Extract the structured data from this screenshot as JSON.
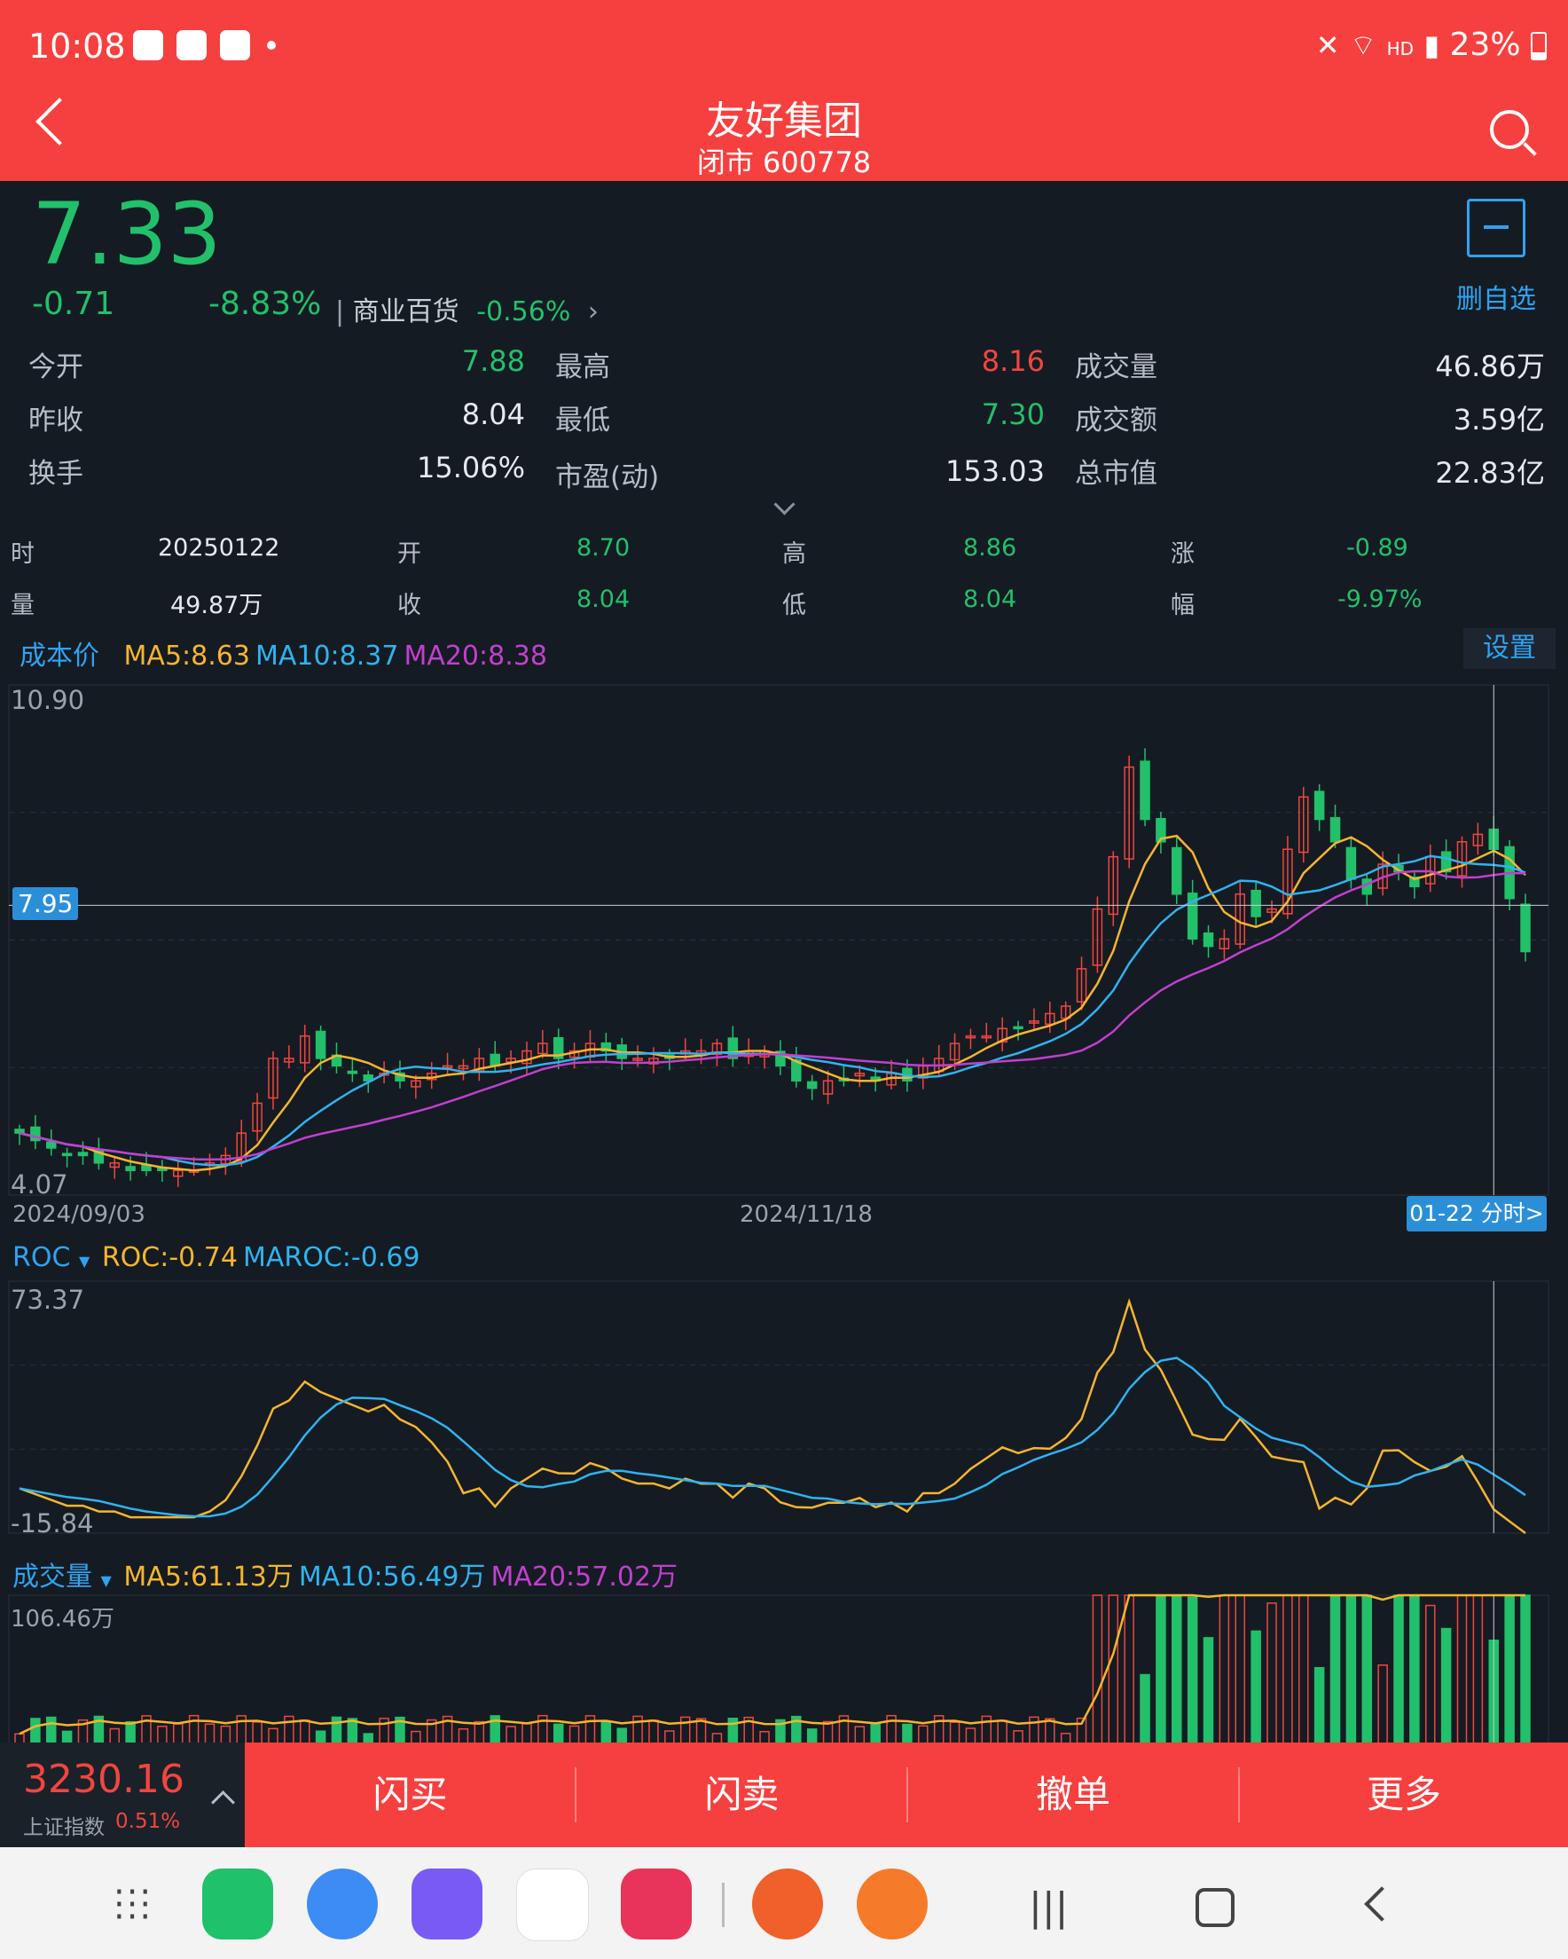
{
  "status": {
    "time": "10:08",
    "battery": "23%",
    "net": "HD"
  },
  "header": {
    "title": "友好集团",
    "subtitle": "闭市 600778"
  },
  "quote": {
    "price": "7.33",
    "change": "-0.71",
    "change_pct": "-8.83%",
    "sector_name": "商业百货",
    "sector_chg": "-0.56%",
    "fav_label": "删自选"
  },
  "stats": {
    "open_l": "今开",
    "open_v": "7.88",
    "high_l": "最高",
    "high_v": "8.16",
    "vol_l": "成交量",
    "vol_v": "46.86万",
    "prev_l": "昨收",
    "prev_v": "8.04",
    "low_l": "最低",
    "low_v": "7.30",
    "amt_l": "成交额",
    "amt_v": "3.59亿",
    "turn_l": "换手",
    "turn_v": "15.06%",
    "pe_l": "市盈(动)",
    "pe_v": "153.03",
    "cap_l": "总市值",
    "cap_v": "22.83亿"
  },
  "bar_info": {
    "time_l": "时",
    "time_v": "20250122",
    "open_l": "开",
    "open_v": "8.70",
    "high_l": "高",
    "high_v": "8.86",
    "chg_l": "涨",
    "chg_v": "-0.89",
    "vol_l": "量",
    "vol_v": "49.87万",
    "close_l": "收",
    "close_v": "8.04",
    "low_l": "低",
    "low_v": "8.04",
    "pct_l": "幅",
    "pct_v": "-9.97%"
  },
  "kline": {
    "cost_label": "成本价",
    "ma5": "MA5:8.63",
    "ma10": "MA10:8.37",
    "ma20": "MA20:8.38",
    "settings": "设置",
    "y_max": "10.90",
    "y_min": "4.07",
    "cross_price": "7.95",
    "date_start": "2024/09/03",
    "date_mid": "2024/11/18",
    "minute_btn": "01-22 分时>"
  },
  "roc": {
    "name": "ROC",
    "roc": "ROC:-0.74",
    "maroc": "MAROC:-0.69",
    "y_max": "73.37",
    "y_min": "-15.84"
  },
  "volume": {
    "name": "成交量",
    "ma5": "MA5:61.13万",
    "ma10": "MA10:56.49万",
    "ma20": "MA20:57.02万",
    "y_max": "106.46万"
  },
  "index": {
    "value": "3230.16",
    "name": "上证指数",
    "chg": "0.51%"
  },
  "trade": {
    "buy": "闪买",
    "sell": "闪卖",
    "cancel": "撤单",
    "more": "更多"
  },
  "colors": {
    "up": "#f0463f",
    "down": "#22c06a",
    "ma5": "#f5b52e",
    "ma10": "#2fb3f0",
    "ma20": "#c23fd0",
    "accent": "#f5403f"
  },
  "chart_data": [
    {
      "type": "candlestick",
      "title": "",
      "x_range": [
        "2024/09/03",
        "2025/01/22"
      ],
      "ylim": [
        4.07,
        10.9
      ],
      "series": [
        {
          "name": "MA5",
          "last": 8.63
        },
        {
          "name": "MA10",
          "last": 8.37
        },
        {
          "name": "MA20",
          "last": 8.38
        }
      ],
      "closes": [
        4.9,
        4.8,
        4.7,
        4.6,
        4.6,
        4.5,
        4.5,
        4.4,
        4.4,
        4.4,
        4.4,
        4.4,
        4.5,
        4.6,
        4.9,
        5.3,
        5.9,
        5.9,
        6.2,
        5.9,
        5.8,
        5.7,
        5.6,
        5.7,
        5.6,
        5.6,
        5.7,
        5.8,
        5.8,
        5.9,
        5.8,
        5.9,
        6.0,
        6.1,
        5.9,
        6.0,
        6.1,
        6.0,
        5.9,
        5.9,
        5.9,
        5.9,
        6.0,
        6.0,
        6.1,
        5.9,
        6.0,
        6.0,
        5.8,
        5.6,
        5.5,
        5.6,
        5.6,
        5.7,
        5.6,
        5.7,
        5.6,
        5.8,
        5.9,
        6.1,
        6.2,
        6.2,
        6.3,
        6.3,
        6.4,
        6.5,
        6.6,
        7.1,
        7.9,
        8.6,
        9.8,
        9.1,
        8.8,
        8.1,
        7.5,
        7.4,
        7.5,
        8.1,
        7.8,
        7.9,
        8.7,
        9.4,
        9.1,
        8.8,
        8.3,
        8.1,
        8.5,
        8.4,
        8.2,
        8.6,
        8.4,
        8.8,
        8.9,
        8.7,
        8.04,
        7.33
      ]
    },
    {
      "type": "line",
      "title": "ROC",
      "ylim": [
        -15.84,
        73.37
      ],
      "series": [
        {
          "name": "ROC",
          "last": -0.74
        },
        {
          "name": "MAROC",
          "last": -0.69
        }
      ]
    },
    {
      "type": "bar",
      "title": "成交量",
      "ylim": [
        0,
        106.46
      ],
      "unit": "万",
      "series": [
        {
          "name": "MA5",
          "last": 61.13
        },
        {
          "name": "MA10",
          "last": 56.49
        },
        {
          "name": "MA20",
          "last": 57.02
        }
      ]
    }
  ]
}
